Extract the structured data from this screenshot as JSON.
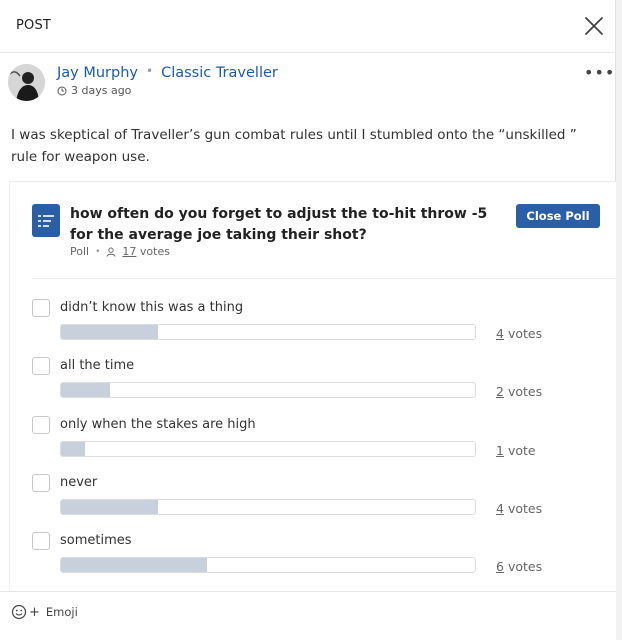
{
  "header": {
    "title": "POST",
    "close_icon": "close-icon"
  },
  "post": {
    "author": "Jay Murphy",
    "community": "Classic Traveller",
    "separator": "•",
    "timestamp": "3 days ago",
    "more_label": "•••",
    "body": "I was skeptical of Traveller’s gun combat rules until I stumbled onto the “unskilled ” rule for weapon use."
  },
  "poll": {
    "question": "how often do you forget to adjust the to-hit throw -5 for the average joe taking their shot?",
    "type_label": "Poll",
    "separator": "•",
    "vote_count": "17",
    "votes_word": "votes",
    "close_button": "Close Poll",
    "accent_color": "#2b5fa5",
    "bar_color": "#c8d1db",
    "options": [
      {
        "label": "didn’t know this was a thing",
        "votes": 4,
        "vote_num": "4",
        "vote_word": "votes",
        "fraction": 0.235
      },
      {
        "label": "all the time",
        "votes": 2,
        "vote_num": "2",
        "vote_word": "votes",
        "fraction": 0.118
      },
      {
        "label": "only when the stakes are high",
        "votes": 1,
        "vote_num": "1",
        "vote_word": "vote",
        "fraction": 0.059
      },
      {
        "label": "never",
        "votes": 4,
        "vote_num": "4",
        "vote_word": "votes",
        "fraction": 0.235
      },
      {
        "label": "sometimes",
        "votes": 6,
        "vote_num": "6",
        "vote_word": "votes",
        "fraction": 0.353
      }
    ]
  },
  "footer": {
    "emoji_label": "Emoji",
    "emoji_icon": "smiley-icon"
  }
}
